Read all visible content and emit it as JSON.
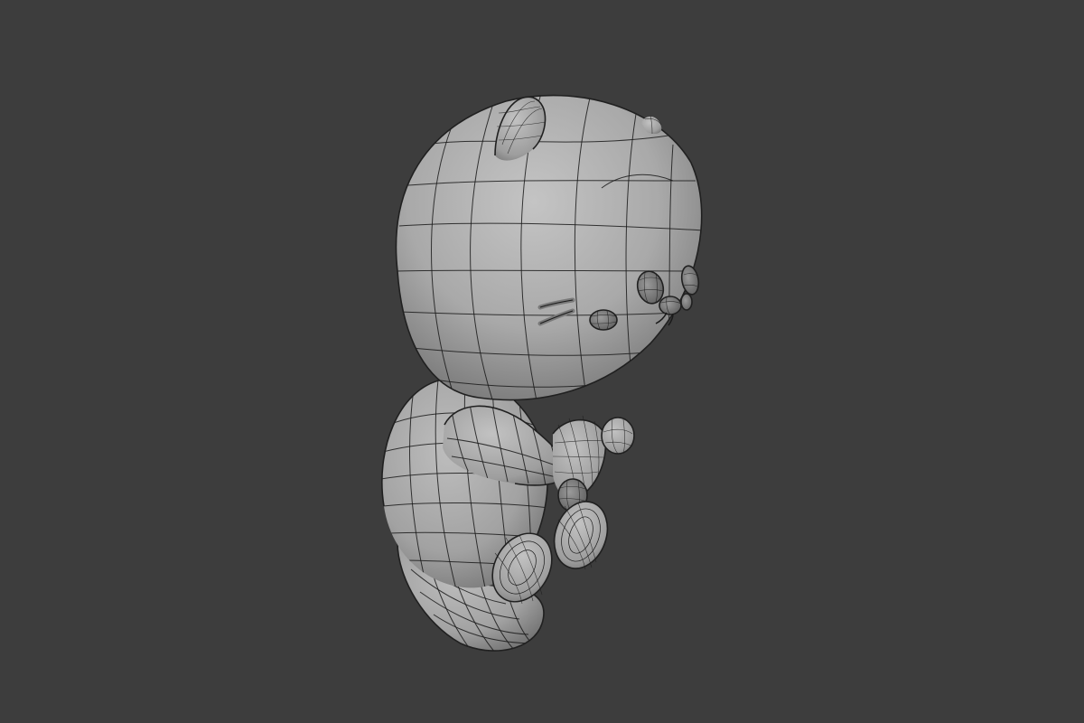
{
  "scene": {
    "background_color": "#3d3d3d",
    "mesh_color": "#a7a7a7",
    "wire_color": "#1a1a1a",
    "subject": "bear-character-mesh",
    "shading": "solid-with-wireframe"
  }
}
